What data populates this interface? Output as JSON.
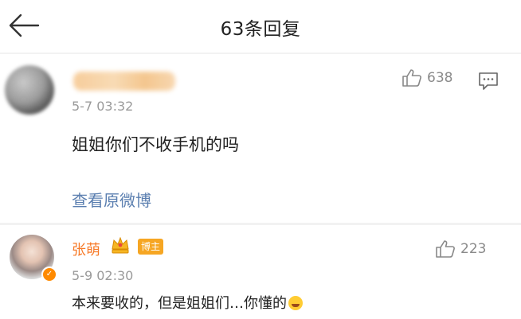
{
  "header": {
    "title": "63条回复",
    "back_icon": "arrow-left-icon"
  },
  "comment": {
    "time": "5-7 03:32",
    "text": "姐姐你们不收手机的吗",
    "likes": "638",
    "view_original": "查看原微博"
  },
  "reply": {
    "author": "张萌",
    "badge": "博主",
    "time": "5-9 02:30",
    "text": "本来要收的，但是姐姐们…你懂的",
    "likes": "223"
  },
  "colors": {
    "author": "#f77a28",
    "link": "#5b7fb0",
    "badge": "#f6a623"
  }
}
